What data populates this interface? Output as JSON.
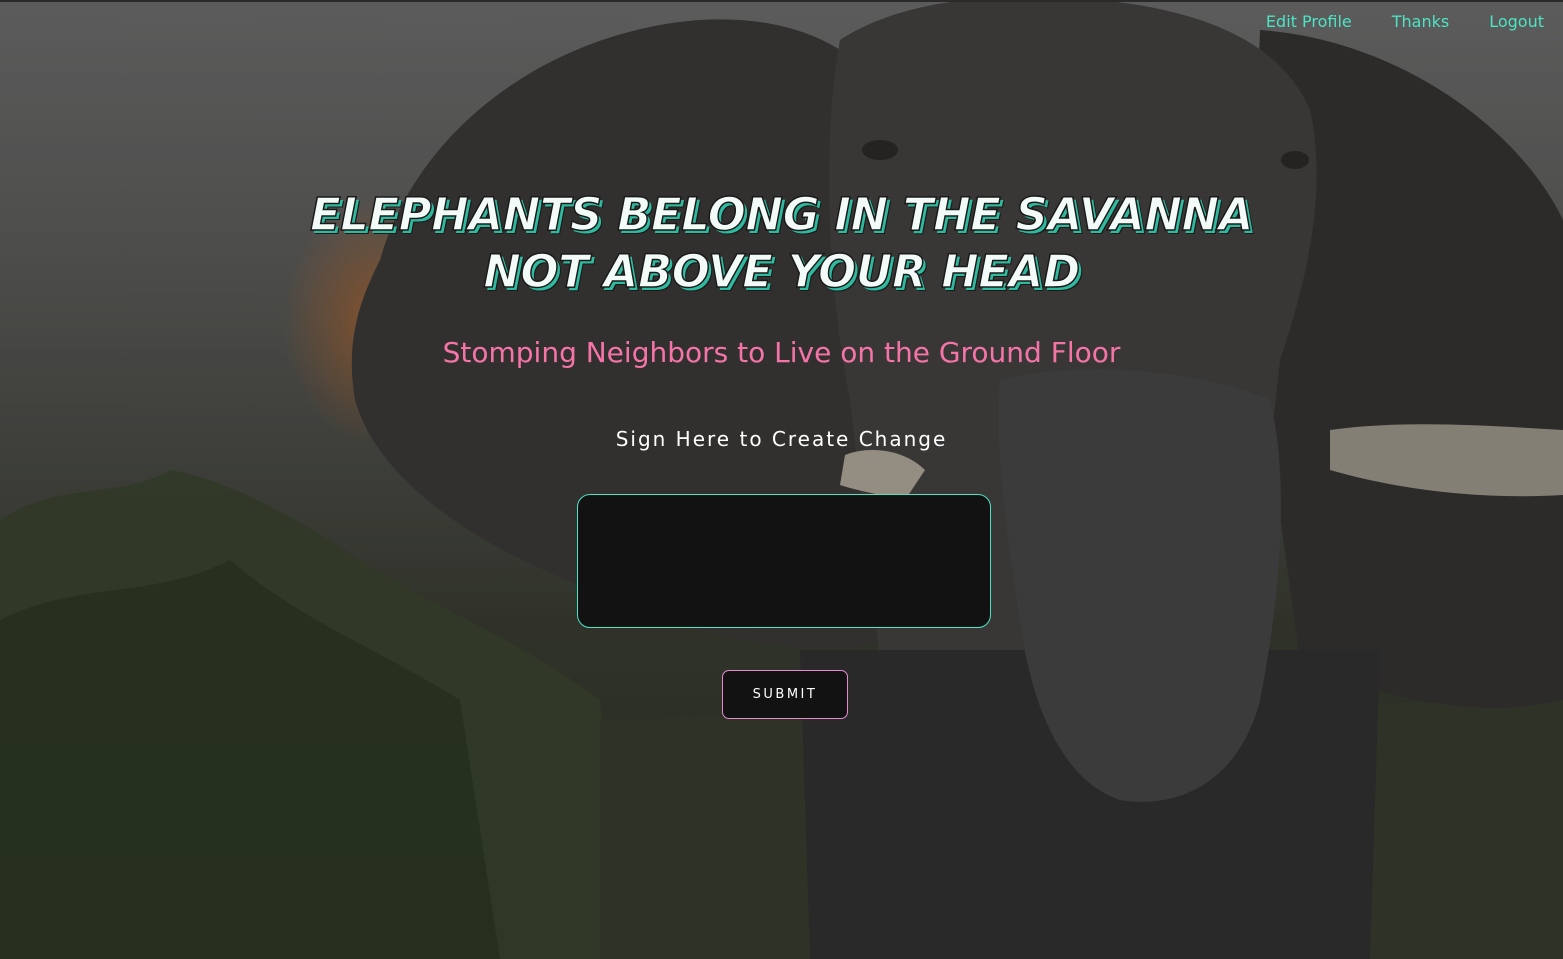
{
  "nav": {
    "edit_profile": "Edit Profile",
    "thanks": "Thanks",
    "logout": "Logout"
  },
  "hero": {
    "title_line1": "ELEPHANTS BELONG IN THE SAVANNA",
    "title_line2": "NOT ABOVE YOUR HEAD",
    "subtitle": "Stomping Neighbors to Live on the Ground Floor",
    "sign_label": "Sign Here to Create Change"
  },
  "form": {
    "submit_label": "SUBMIT"
  },
  "colors": {
    "accent_teal": "#4de3c5",
    "accent_pink": "#f574a8",
    "button_border": "#e58bd0",
    "panel_bg": "#121213"
  }
}
